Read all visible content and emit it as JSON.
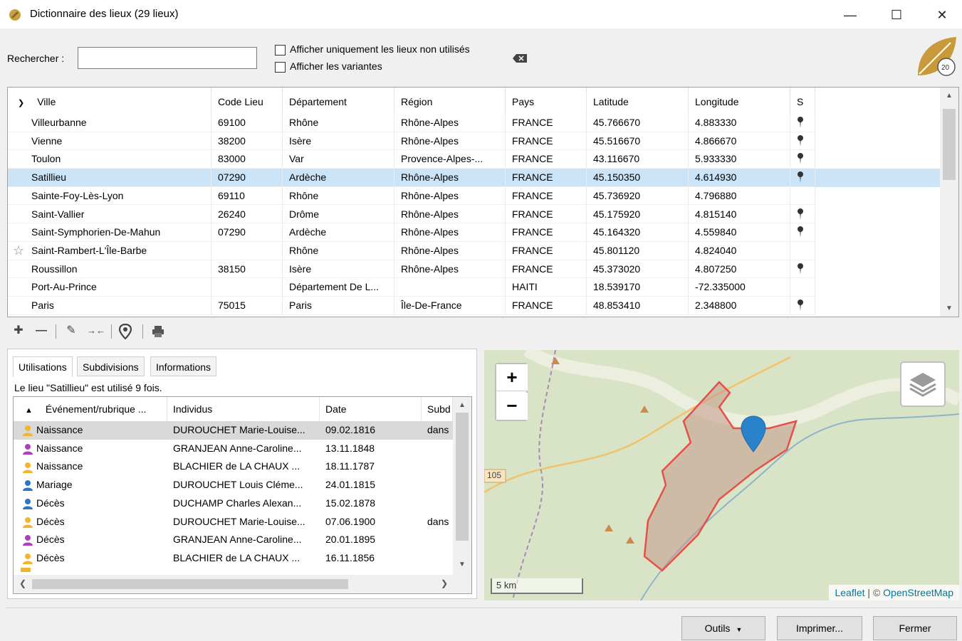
{
  "window": {
    "title": "Dictionnaire des lieux (29 lieux)",
    "minimize": "—",
    "maximize": "☐",
    "close": "✕"
  },
  "search": {
    "label": "Rechercher :",
    "value": "",
    "opt_unused": "Afficher uniquement les lieux non utilisés",
    "opt_variants": "Afficher les variantes"
  },
  "grid": {
    "headers": [
      "Ville",
      "Code Lieu",
      "Département",
      "Région",
      "Pays",
      "Latitude",
      "Longitude",
      "S"
    ],
    "rows": [
      {
        "ville": "Villeurbanne",
        "code": "69100",
        "dept": "Rhône",
        "region": "Rhône-Alpes",
        "pays": "FRANCE",
        "lat": "45.766670",
        "lon": "4.883330",
        "pin": true,
        "star": false
      },
      {
        "ville": "Vienne",
        "code": "38200",
        "dept": "Isère",
        "region": "Rhône-Alpes",
        "pays": "FRANCE",
        "lat": "45.516670",
        "lon": "4.866670",
        "pin": true,
        "star": false
      },
      {
        "ville": "Toulon",
        "code": "83000",
        "dept": "Var",
        "region": "Provence-Alpes-...",
        "pays": "FRANCE",
        "lat": "43.116670",
        "lon": "5.933330",
        "pin": true,
        "star": false
      },
      {
        "ville": "Satillieu",
        "code": "07290",
        "dept": "Ardèche",
        "region": "Rhône-Alpes",
        "pays": "FRANCE",
        "lat": "45.150350",
        "lon": "4.614930",
        "pin": true,
        "star": false
      },
      {
        "ville": "Sainte-Foy-Lès-Lyon",
        "code": "69110",
        "dept": "Rhône",
        "region": "Rhône-Alpes",
        "pays": "FRANCE",
        "lat": "45.736920",
        "lon": "4.796880",
        "pin": false,
        "star": false
      },
      {
        "ville": "Saint-Vallier",
        "code": "26240",
        "dept": "Drôme",
        "region": "Rhône-Alpes",
        "pays": "FRANCE",
        "lat": "45.175920",
        "lon": "4.815140",
        "pin": true,
        "star": false
      },
      {
        "ville": "Saint-Symphorien-De-Mahun",
        "code": "07290",
        "dept": "Ardèche",
        "region": "Rhône-Alpes",
        "pays": "FRANCE",
        "lat": "45.164320",
        "lon": "4.559840",
        "pin": true,
        "star": false
      },
      {
        "ville": "Saint-Rambert-L'Île-Barbe",
        "code": "",
        "dept": "Rhône",
        "region": "Rhône-Alpes",
        "pays": "FRANCE",
        "lat": "45.801120",
        "lon": "4.824040",
        "pin": false,
        "star": true
      },
      {
        "ville": "Roussillon",
        "code": "38150",
        "dept": "Isère",
        "region": "Rhône-Alpes",
        "pays": "FRANCE",
        "lat": "45.373020",
        "lon": "4.807250",
        "pin": true,
        "star": false
      },
      {
        "ville": "Port-Au-Prince",
        "code": "",
        "dept": "Département De L...",
        "region": "",
        "pays": "HAITI",
        "lat": "18.539170",
        "lon": "-72.335000",
        "pin": false,
        "star": false
      },
      {
        "ville": "Paris",
        "code": "75015",
        "dept": "Paris",
        "region": "Île-De-France",
        "pays": "FRANCE",
        "lat": "48.853410",
        "lon": "2.348800",
        "pin": true,
        "star": false
      }
    ]
  },
  "tabs": [
    "Utilisations",
    "Subdivisions",
    "Informations"
  ],
  "usage_text": "Le lieu \"Satillieu\" est utilisé 9 fois.",
  "subgrid": {
    "headers": [
      "Événement/rubrique ...",
      "Individus",
      "Date",
      "Subd"
    ],
    "rows": [
      {
        "event": "Naissance",
        "person": "DUROUCHET Marie-Louise...",
        "date": "09.02.1816",
        "subd": "dans",
        "sex": "f"
      },
      {
        "event": "Naissance",
        "person": "GRANJEAN Anne-Caroline...",
        "date": "13.11.1848",
        "subd": "",
        "sex": "p"
      },
      {
        "event": "Naissance",
        "person": "BLACHIER de LA CHAUX ...",
        "date": "18.11.1787",
        "subd": "",
        "sex": "f"
      },
      {
        "event": "Mariage",
        "person": "DUROUCHET Louis Cléme...",
        "date": "24.01.1815",
        "subd": "",
        "sex": "m"
      },
      {
        "event": "Décès",
        "person": "DUCHAMP Charles Alexan...",
        "date": "15.02.1878",
        "subd": "",
        "sex": "m"
      },
      {
        "event": "Décès",
        "person": "DUROUCHET Marie-Louise...",
        "date": "07.06.1900",
        "subd": "dans",
        "sex": "f"
      },
      {
        "event": "Décès",
        "person": "GRANJEAN Anne-Caroline...",
        "date": "20.01.1895",
        "subd": "",
        "sex": "p"
      },
      {
        "event": "Décès",
        "person": "BLACHIER de LA CHAUX ...",
        "date": "16.11.1856",
        "subd": "",
        "sex": "f"
      }
    ]
  },
  "map": {
    "zoom_in": "+",
    "zoom_out": "−",
    "road_label": "105",
    "scale": "5 km",
    "attribution_leaflet": "Leaflet",
    "attribution_sep": " | © ",
    "attribution_osm": "OpenStreetMap"
  },
  "footer": {
    "tools": "Outils",
    "print": "Imprimer...",
    "close": "Fermer"
  }
}
